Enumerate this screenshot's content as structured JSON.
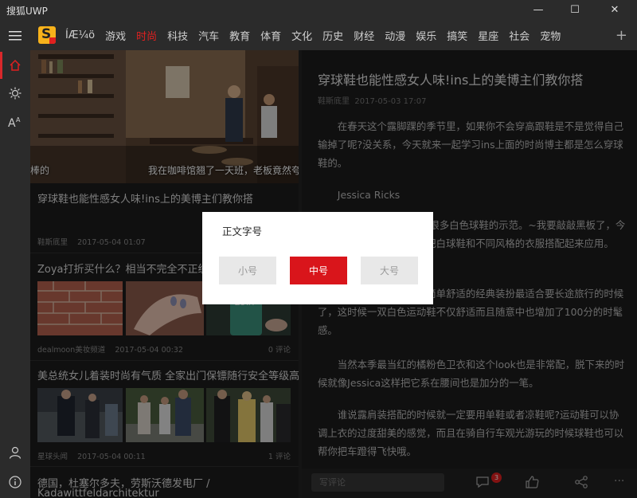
{
  "window": {
    "title": "搜狐UWP",
    "minimize_glyph": "—",
    "maximize_glyph": "☐",
    "close_glyph": "✕"
  },
  "colors": {
    "accent": "#e02020",
    "background": "#1c1c1c",
    "panel": "#2b2b2b",
    "dialog": "#ffffff"
  },
  "nav": {
    "tabs": [
      {
        "label": "ÍÆ¼ö",
        "active": false
      },
      {
        "label": "游戏",
        "active": false
      },
      {
        "label": "时尚",
        "active": true
      },
      {
        "label": "科技",
        "active": false
      },
      {
        "label": "汽车",
        "active": false
      },
      {
        "label": "教育",
        "active": false
      },
      {
        "label": "体育",
        "active": false
      },
      {
        "label": "文化",
        "active": false
      },
      {
        "label": "历史",
        "active": false
      },
      {
        "label": "财经",
        "active": false
      },
      {
        "label": "动漫",
        "active": false
      },
      {
        "label": "娱乐",
        "active": false
      },
      {
        "label": "搞笑",
        "active": false
      },
      {
        "label": "星座",
        "active": false
      },
      {
        "label": "社会",
        "active": false
      },
      {
        "label": "宠物",
        "active": false
      }
    ],
    "add_icon": "plus-icon",
    "plus_glyph": "+"
  },
  "rail": {
    "icons": [
      "hamburger-menu-icon",
      "home-icon",
      "brightness-icon",
      "font-size-icon",
      "user-icon",
      "info-icon"
    ]
  },
  "feed": {
    "hero": {
      "caption_left": "棒的",
      "caption_right": "我在咖啡馆翘了一天班，老板竟然夸",
      "title": "穿球鞋也能性感女人味!ins上的美博主们教你搭",
      "source": "鞋斯底里",
      "date": "2017-05-04 01:07"
    },
    "items": [
      {
        "title": "Zoya打折买什么？相当不完全不正统选色清单",
        "source": "dealmoon美妆频道",
        "date": "2017-05-04 00:32",
        "comments": "0 评论"
      },
      {
        "title": "美总统女儿着装时尚有气质 全家出门保镖随行安全等级高",
        "source": "星球头闻",
        "date": "2017-05-04 00:11",
        "comments": "1 评论"
      },
      {
        "title": "德国，杜塞尔多夫，劳斯沃德发电厂 /",
        "title2": "Kadawittfeldarchitektur"
      }
    ]
  },
  "article": {
    "title": "穿球鞋也能性感女人味!ins上的美博主们教你搭",
    "source": "鞋斯底里",
    "date": "2017-05-03 17:07",
    "paragraphs": [
      "在春天这个露脚踝的季节里，如果你不会穿高跟鞋是不是觉得自己输掉了呢?没关系，今天就来一起学习ins上面的时尚博主都是怎么穿球鞋的。",
      "Jessica Ricks",
      "Jessica Ricks身上有很多白色球鞋的示范。~我要敲敲黑板了，今天就跟大家一起看看如何把白球鞋和不同风格的衣服搭配起来应用。",
      "穿衣搭配上，她那身简单舒适的经典装扮最适合要长途旅行的时候了，这时候一双白色运动鞋不仅舒适而且随意中也增加了100分的时髦感。",
      "当然本季最当红的橘粉色卫衣和这个look也是非常配，脱下来的时候就像Jessica这样把它系在腰间也是加分的一笔。",
      "谁说露肩装搭配的时候就一定要用单鞋或者凉鞋呢?运动鞋可以协调上衣的过度甜美的感觉，而且在骑自行车观光游玩的时候球鞋也可以帮你把车蹬得飞快哦。"
    ]
  },
  "bottombar": {
    "comment_placeholder": "写评论",
    "comment_badge": "3",
    "more_label": "···"
  },
  "dialog": {
    "title": "正文字号",
    "options": [
      {
        "label": "小号",
        "selected": false
      },
      {
        "label": "中号",
        "selected": true
      },
      {
        "label": "大号",
        "selected": false
      }
    ]
  }
}
